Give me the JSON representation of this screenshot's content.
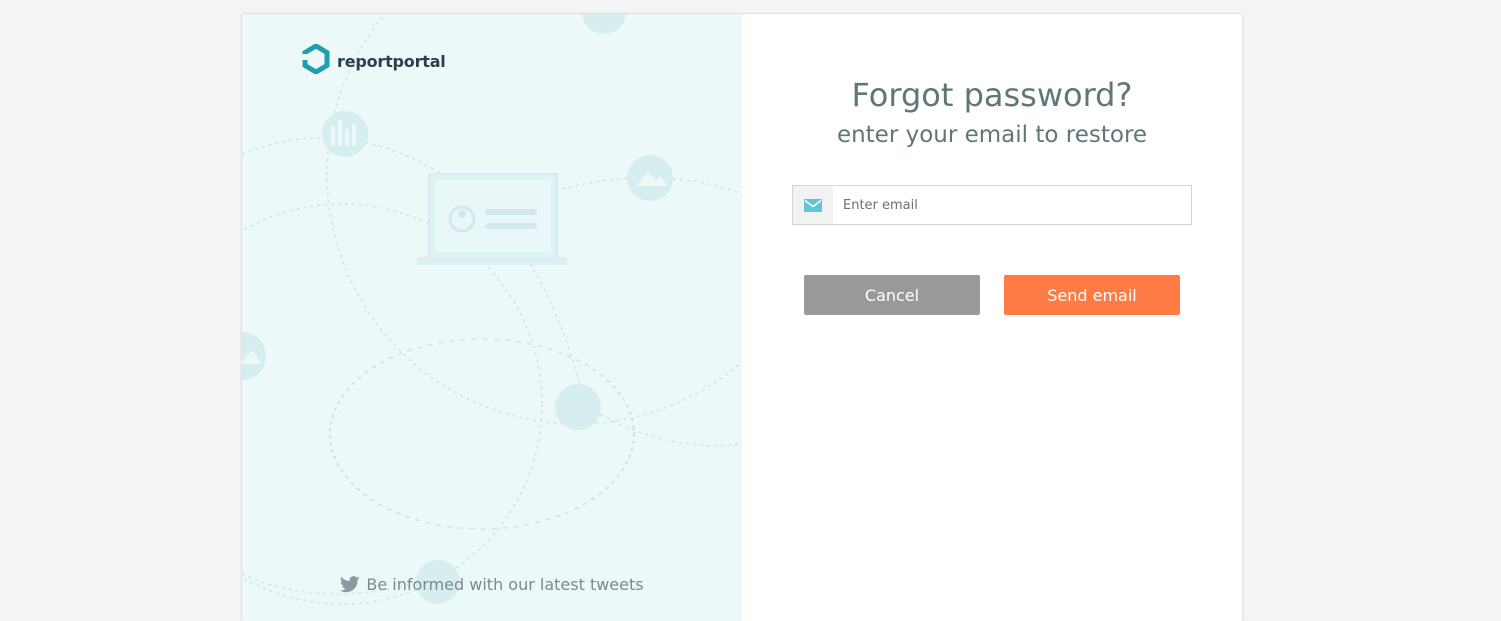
{
  "brand": {
    "name": "reportportal",
    "logo_icon": "reportportal-hexagon-logo",
    "logo_color": "#1d9fb0"
  },
  "promo": {
    "tweets_text": "Be informed with our latest tweets",
    "tweets_icon": "twitter-icon",
    "background_color": "#edf8f9"
  },
  "form": {
    "title": "Forgot password?",
    "subtitle": "enter your email to restore",
    "email": {
      "icon": "mail-icon",
      "placeholder": "Enter email",
      "value": ""
    },
    "cancel_label": "Cancel",
    "send_label": "Send email"
  },
  "colors": {
    "cancel_button": "#999999",
    "send_button": "#ff7b46",
    "title_text": "#5f7779",
    "page_background": "#f4f4f4"
  }
}
